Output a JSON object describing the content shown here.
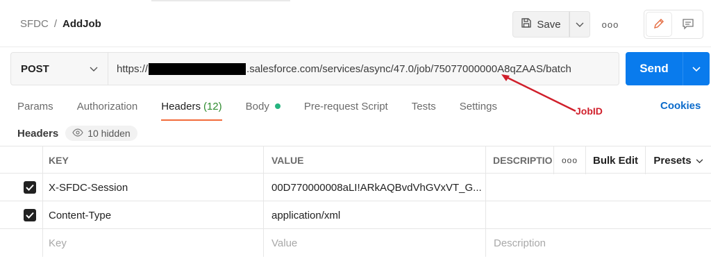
{
  "title_bar": {
    "breadcrumb_parent": "SFDC",
    "breadcrumb_separator": "/",
    "breadcrumb_current": "AddJob",
    "save_label": "Save"
  },
  "request": {
    "method": "POST",
    "url_prefix": "https://",
    "url_suffix": ".salesforce.com/services/async/47.0/job/75077000000A8qZAAS/batch",
    "send_label": "Send"
  },
  "annotation": {
    "label": "JobID",
    "color": "#d01f2b"
  },
  "tabs": [
    {
      "label": "Params"
    },
    {
      "label": "Authorization"
    },
    {
      "label": "Headers",
      "count": "(12)"
    },
    {
      "label": "Body"
    },
    {
      "label": "Pre-request Script"
    },
    {
      "label": "Tests"
    },
    {
      "label": "Settings"
    }
  ],
  "cookies_label": "Cookies",
  "headers_section": {
    "label": "Headers",
    "hidden_label": "10 hidden"
  },
  "table": {
    "columns": {
      "key": "KEY",
      "value": "VALUE",
      "description": "DESCRIPTIO",
      "bulk_edit": "Bulk Edit",
      "presets": "Presets"
    },
    "rows": [
      {
        "key": "X-SFDC-Session",
        "value": "00D770000008aLI!ARkAQBvdVhGVxVT_G...",
        "checked": true
      },
      {
        "key": "Content-Type",
        "value": "application/xml",
        "checked": true
      }
    ],
    "placeholders": {
      "key": "Key",
      "value": "Value",
      "description": "Description"
    }
  },
  "colors": {
    "accent_send": "#097bed",
    "active_tab_underline": "#f26b3a",
    "body_dot": "#26b47f",
    "cookies_link": "#0b6bcb"
  }
}
